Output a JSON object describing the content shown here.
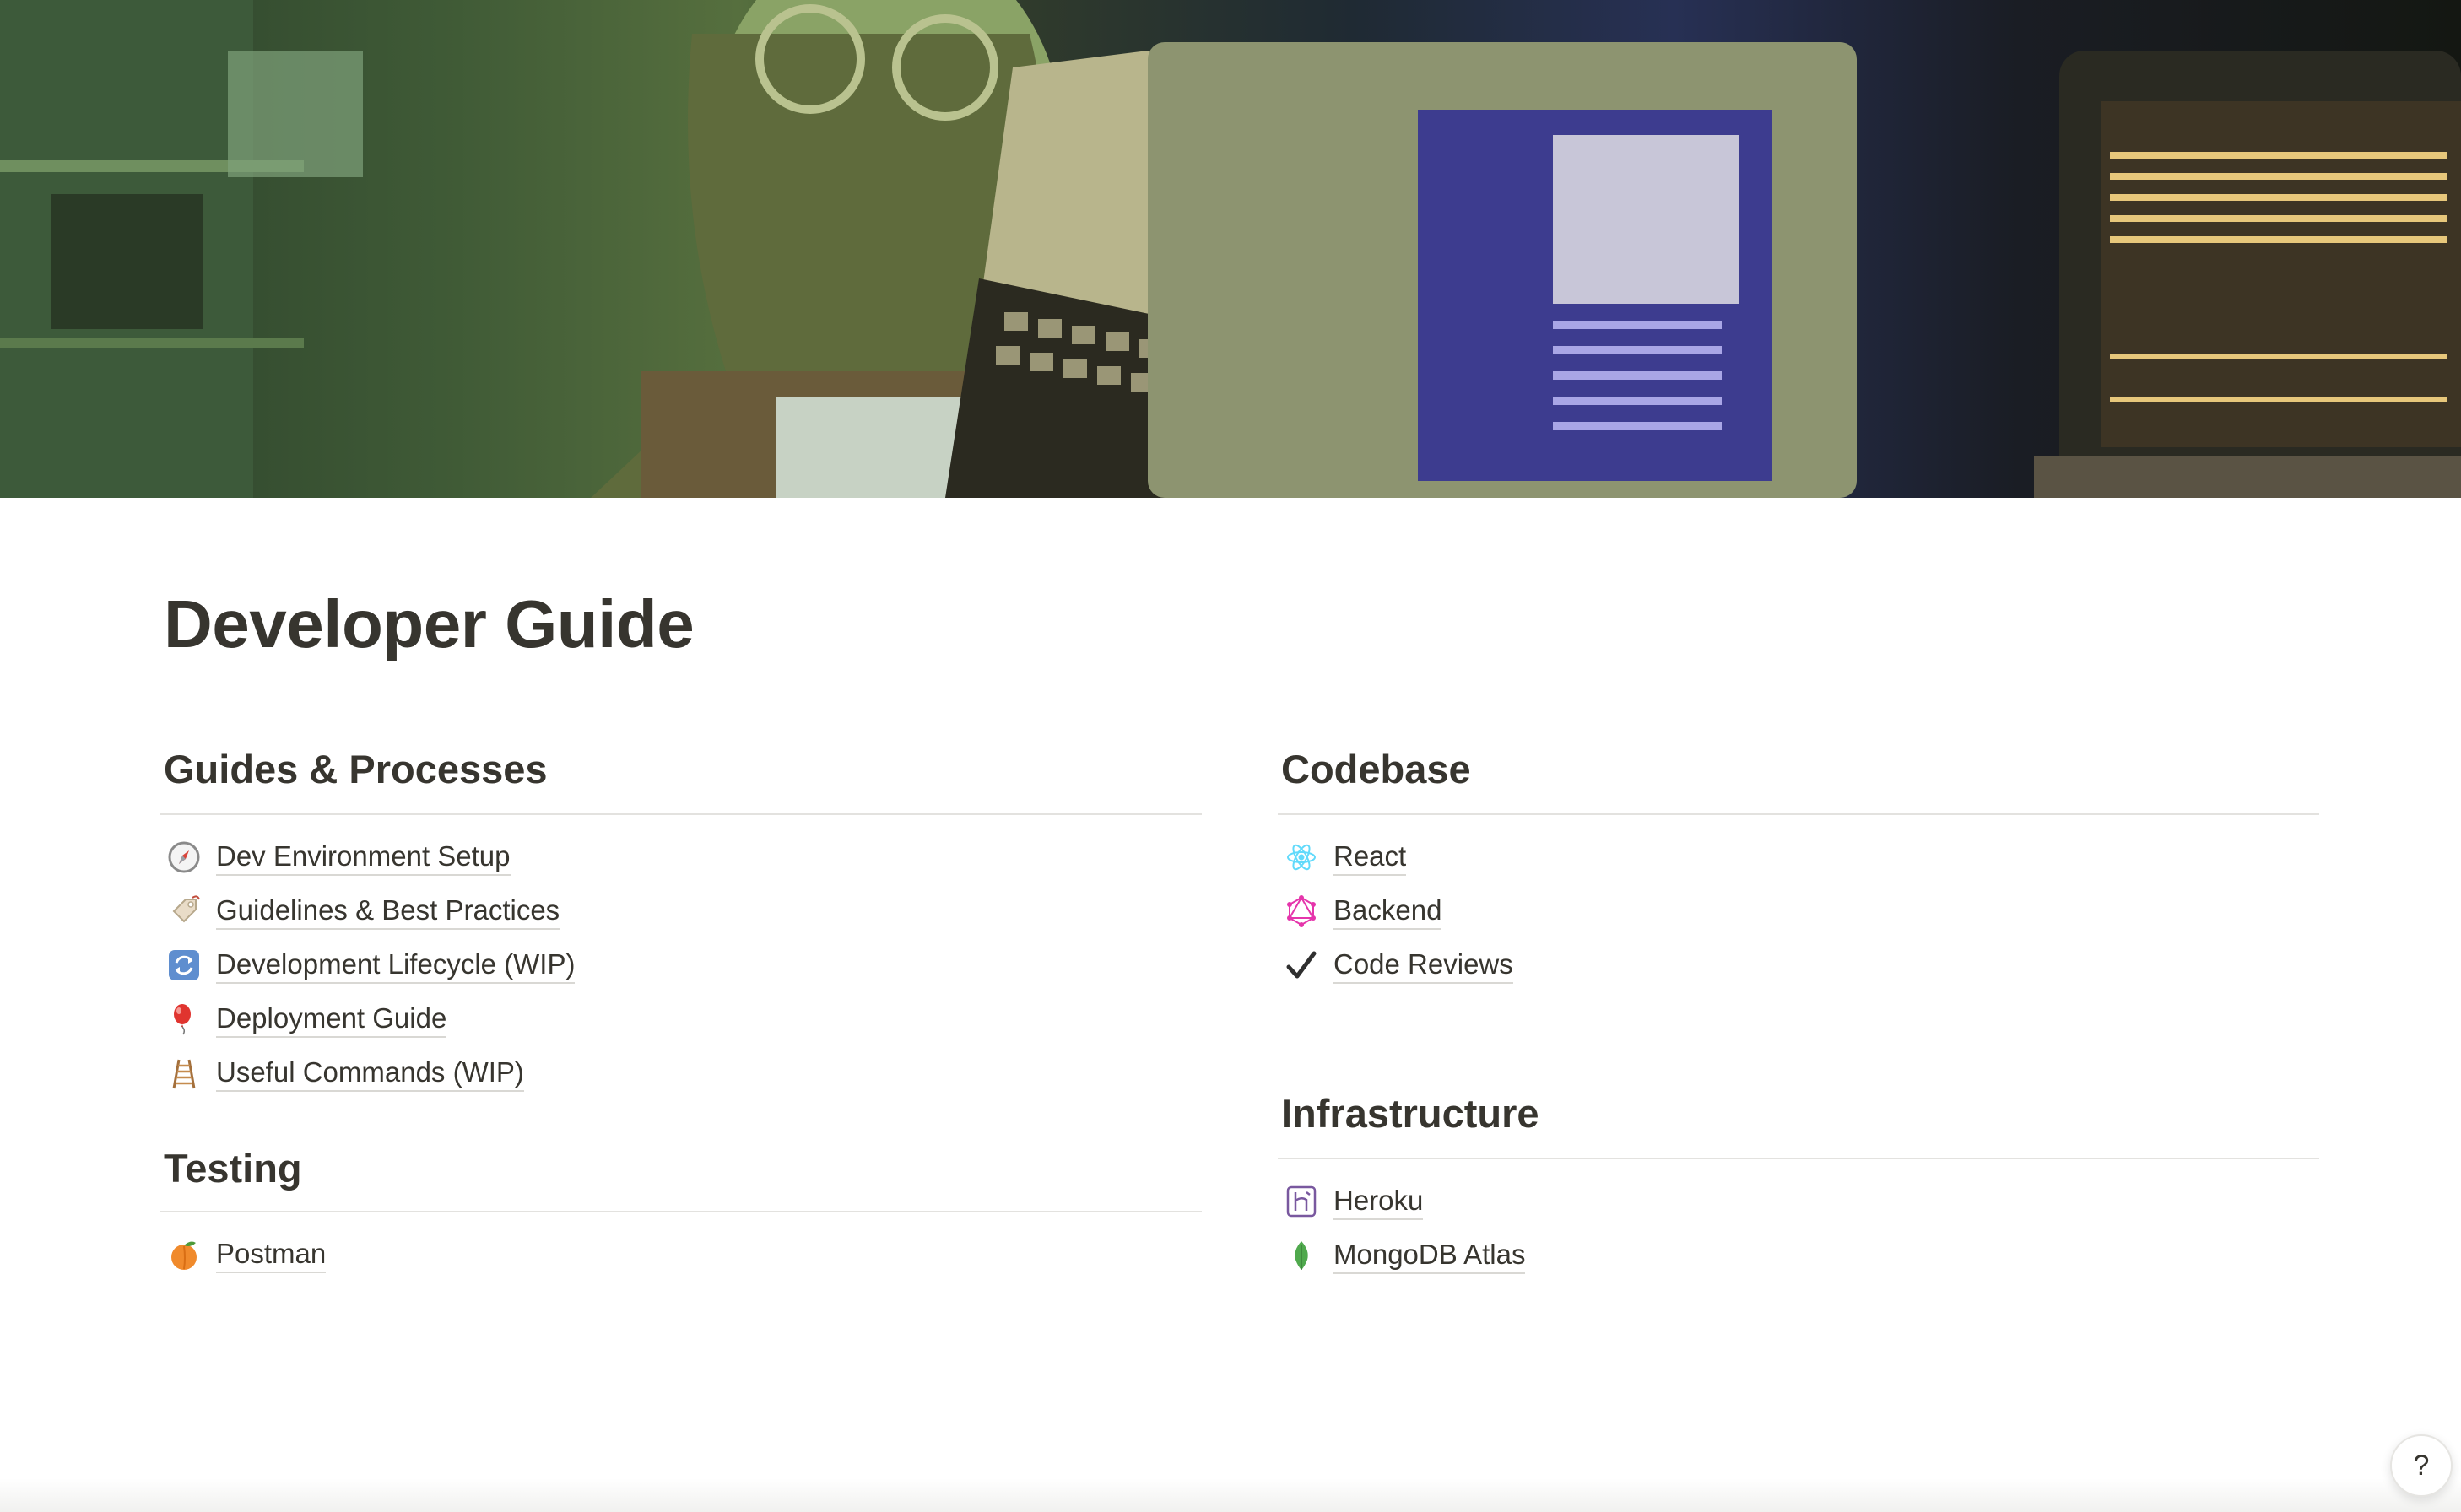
{
  "page": {
    "title": "Developer Guide"
  },
  "cover": {
    "description_icon": "cover-photo"
  },
  "sections": {
    "guides": {
      "heading": "Guides & Processes",
      "items": [
        {
          "label": "Dev Environment Setup",
          "icon": "compass-icon"
        },
        {
          "label": "Guidelines & Best Practices",
          "icon": "tag-icon"
        },
        {
          "label": "Development Lifecycle (WIP)",
          "icon": "cycle-arrows-icon"
        },
        {
          "label": "Deployment Guide",
          "icon": "balloon-icon"
        },
        {
          "label": "Useful Commands (WIP)",
          "icon": "ladder-icon"
        }
      ]
    },
    "testing": {
      "heading": "Testing",
      "items": [
        {
          "label": "Postman",
          "icon": "peach-icon"
        }
      ]
    },
    "codebase": {
      "heading": "Codebase",
      "items": [
        {
          "label": "React",
          "icon": "react-icon"
        },
        {
          "label": "Backend",
          "icon": "graphql-icon"
        },
        {
          "label": "Code Reviews",
          "icon": "checkmark-icon"
        }
      ]
    },
    "infrastructure": {
      "heading": "Infrastructure",
      "items": [
        {
          "label": "Heroku",
          "icon": "heroku-icon"
        },
        {
          "label": "MongoDB Atlas",
          "icon": "mongodb-leaf-icon"
        }
      ]
    }
  },
  "help": {
    "label": "?"
  },
  "colors": {
    "text": "#37352f",
    "divider": "#e3e2df",
    "graphql_pink": "#e535ab",
    "react_blue": "#61dafb",
    "heroku_purple": "#79589f",
    "mongodb_green": "#4fa94d"
  }
}
